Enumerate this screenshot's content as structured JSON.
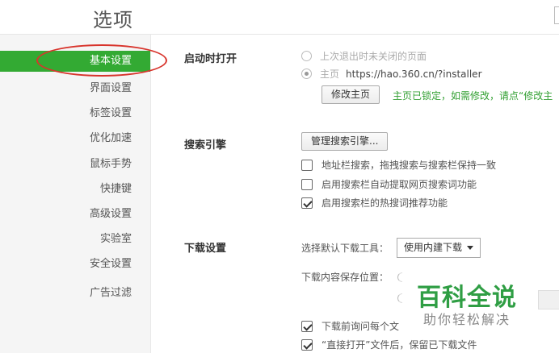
{
  "page": {
    "title": "选项"
  },
  "sidebar": {
    "items": [
      {
        "label": "基本设置",
        "active": true
      },
      {
        "label": "界面设置"
      },
      {
        "label": "标签设置"
      },
      {
        "label": "优化加速"
      },
      {
        "label": "鼠标手势"
      },
      {
        "label": "快捷键"
      },
      {
        "label": "高级设置"
      },
      {
        "label": "实验室"
      },
      {
        "label": "安全设置"
      },
      {
        "label": "广告过滤"
      }
    ]
  },
  "startup": {
    "label": "启动时打开",
    "option_last_session": "上次退出时未关闭的页面",
    "option_homepage": "主页",
    "homepage_url": "https://hao.360.cn/?installer",
    "modify_button": "修改主页",
    "lock_note": "主页已锁定，如需修改，请点“修改主"
  },
  "search": {
    "label": "搜索引擎",
    "manage_button": "管理搜索引擎...",
    "options": [
      {
        "label": "地址栏搜索，拖拽搜索与搜索栏保持一致",
        "checked": false
      },
      {
        "label": "启用搜索栏自动提取网页搜索词功能",
        "checked": false
      },
      {
        "label": "启用搜索栏的热搜词推荐功能",
        "checked": true
      }
    ]
  },
  "download": {
    "label": "下载设置",
    "tool_label": "选择默认下载工具：",
    "tool_selected": "使用内建下载",
    "save_location_label": "下载内容保存位置：",
    "ask_label": "下载前询问每个文",
    "keep_label": "“直接打开”文件后，保留已下载文件",
    "ask_checked": true,
    "keep_checked": true
  },
  "watermark": {
    "title": "百科全说",
    "subtitle": "助你轻松解决"
  },
  "colors": {
    "active_nav": "#33aa33",
    "highlight_circle": "#d8342c",
    "lock_note": "#33a033",
    "watermark": "#2f9e44"
  }
}
